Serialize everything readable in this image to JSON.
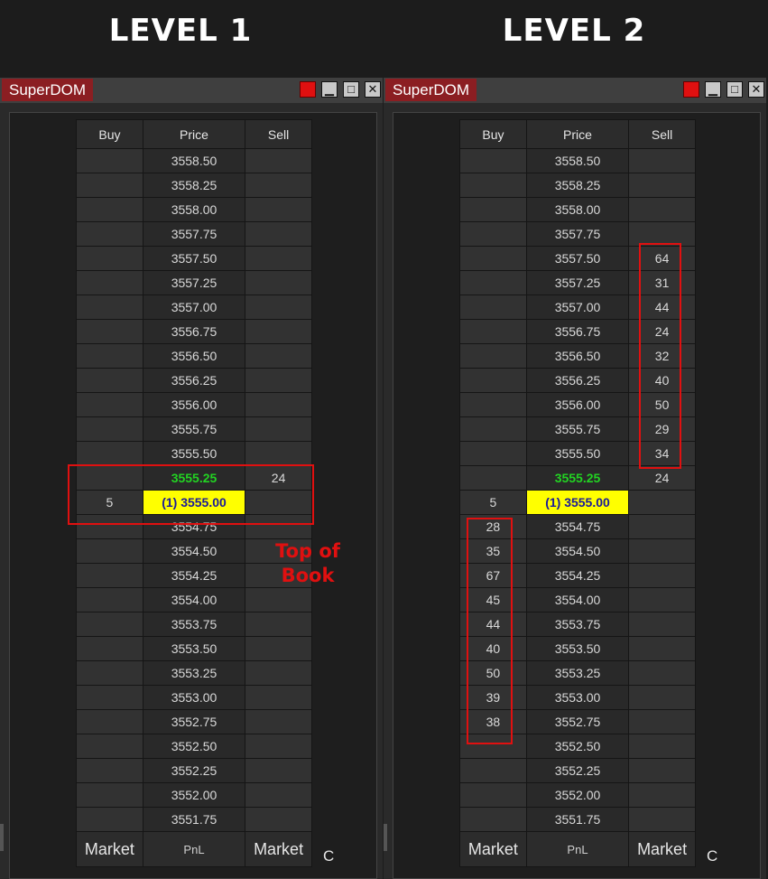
{
  "headings": {
    "left": "LEVEL 1",
    "right": "LEVEL 2"
  },
  "window_title": "SuperDOM",
  "columns": {
    "buy": "Buy",
    "price": "Price",
    "sell": "Sell"
  },
  "footer": {
    "market_buy": "Market",
    "pnl": "PnL",
    "market_sell": "Market",
    "close": "C"
  },
  "annotation": "Top of Book",
  "colors": {
    "last_price": "#22d322",
    "position_bg": "#ffff00",
    "highlight_box": "#e01010",
    "title_tab": "#8b1e22"
  },
  "level1": {
    "rows": [
      {
        "buy": "",
        "price": "3558.50",
        "sell": ""
      },
      {
        "buy": "",
        "price": "3558.25",
        "sell": ""
      },
      {
        "buy": "",
        "price": "3558.00",
        "sell": ""
      },
      {
        "buy": "",
        "price": "3557.75",
        "sell": ""
      },
      {
        "buy": "",
        "price": "3557.50",
        "sell": ""
      },
      {
        "buy": "",
        "price": "3557.25",
        "sell": ""
      },
      {
        "buy": "",
        "price": "3557.00",
        "sell": ""
      },
      {
        "buy": "",
        "price": "3556.75",
        "sell": ""
      },
      {
        "buy": "",
        "price": "3556.50",
        "sell": ""
      },
      {
        "buy": "",
        "price": "3556.25",
        "sell": ""
      },
      {
        "buy": "",
        "price": "3556.00",
        "sell": ""
      },
      {
        "buy": "",
        "price": "3555.75",
        "sell": ""
      },
      {
        "buy": "",
        "price": "3555.50",
        "sell": ""
      },
      {
        "buy": "",
        "price": "3555.25",
        "sell": "24",
        "style": "last"
      },
      {
        "buy": "5",
        "price": "(1) 3555.00",
        "sell": "",
        "style": "pos"
      },
      {
        "buy": "",
        "price": "3554.75",
        "sell": ""
      },
      {
        "buy": "",
        "price": "3554.50",
        "sell": ""
      },
      {
        "buy": "",
        "price": "3554.25",
        "sell": ""
      },
      {
        "buy": "",
        "price": "3554.00",
        "sell": ""
      },
      {
        "buy": "",
        "price": "3553.75",
        "sell": ""
      },
      {
        "buy": "",
        "price": "3553.50",
        "sell": ""
      },
      {
        "buy": "",
        "price": "3553.25",
        "sell": ""
      },
      {
        "buy": "",
        "price": "3553.00",
        "sell": ""
      },
      {
        "buy": "",
        "price": "3552.75",
        "sell": ""
      },
      {
        "buy": "",
        "price": "3552.50",
        "sell": ""
      },
      {
        "buy": "",
        "price": "3552.25",
        "sell": ""
      },
      {
        "buy": "",
        "price": "3552.00",
        "sell": ""
      },
      {
        "buy": "",
        "price": "3551.75",
        "sell": ""
      }
    ]
  },
  "level2": {
    "rows": [
      {
        "buy": "",
        "price": "3558.50",
        "sell": ""
      },
      {
        "buy": "",
        "price": "3558.25",
        "sell": ""
      },
      {
        "buy": "",
        "price": "3558.00",
        "sell": ""
      },
      {
        "buy": "",
        "price": "3557.75",
        "sell": ""
      },
      {
        "buy": "",
        "price": "3557.50",
        "sell": "64"
      },
      {
        "buy": "",
        "price": "3557.25",
        "sell": "31"
      },
      {
        "buy": "",
        "price": "3557.00",
        "sell": "44"
      },
      {
        "buy": "",
        "price": "3556.75",
        "sell": "24"
      },
      {
        "buy": "",
        "price": "3556.50",
        "sell": "32"
      },
      {
        "buy": "",
        "price": "3556.25",
        "sell": "40"
      },
      {
        "buy": "",
        "price": "3556.00",
        "sell": "50"
      },
      {
        "buy": "",
        "price": "3555.75",
        "sell": "29"
      },
      {
        "buy": "",
        "price": "3555.50",
        "sell": "34"
      },
      {
        "buy": "",
        "price": "3555.25",
        "sell": "24",
        "style": "last"
      },
      {
        "buy": "5",
        "price": "(1) 3555.00",
        "sell": "",
        "style": "pos"
      },
      {
        "buy": "28",
        "price": "3554.75",
        "sell": ""
      },
      {
        "buy": "35",
        "price": "3554.50",
        "sell": ""
      },
      {
        "buy": "67",
        "price": "3554.25",
        "sell": ""
      },
      {
        "buy": "45",
        "price": "3554.00",
        "sell": ""
      },
      {
        "buy": "44",
        "price": "3553.75",
        "sell": ""
      },
      {
        "buy": "40",
        "price": "3553.50",
        "sell": ""
      },
      {
        "buy": "50",
        "price": "3553.25",
        "sell": ""
      },
      {
        "buy": "39",
        "price": "3553.00",
        "sell": ""
      },
      {
        "buy": "38",
        "price": "3552.75",
        "sell": ""
      },
      {
        "buy": "",
        "price": "3552.50",
        "sell": ""
      },
      {
        "buy": "",
        "price": "3552.25",
        "sell": ""
      },
      {
        "buy": "",
        "price": "3552.00",
        "sell": ""
      },
      {
        "buy": "",
        "price": "3551.75",
        "sell": ""
      }
    ]
  }
}
